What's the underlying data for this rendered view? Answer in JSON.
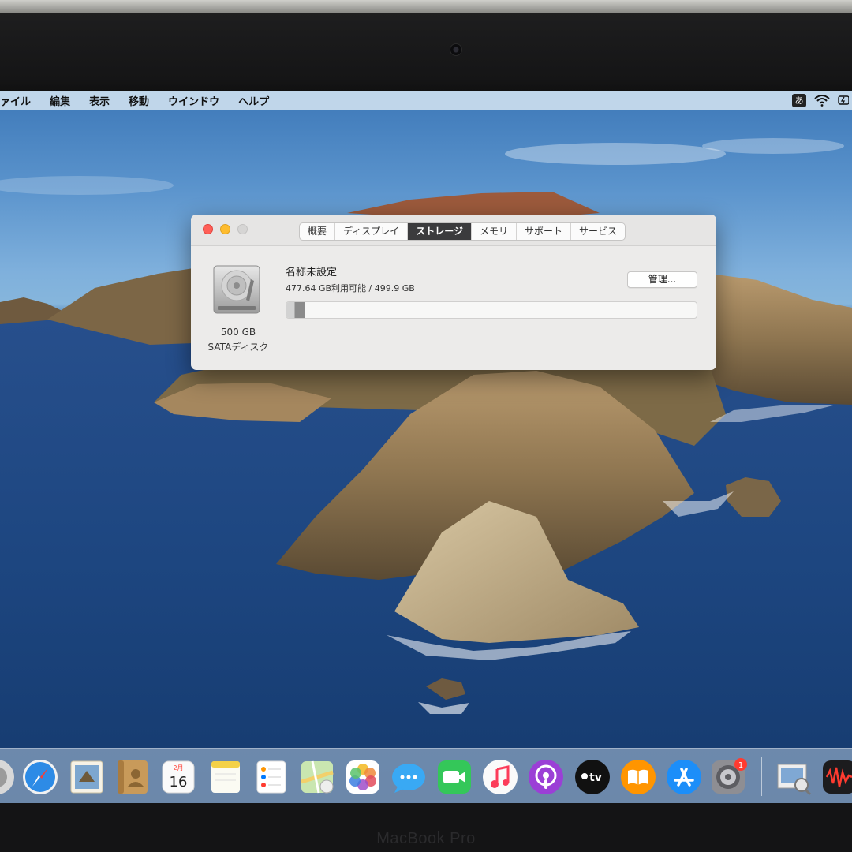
{
  "device": {
    "model_label": "MacBook Pro"
  },
  "menubar": {
    "items": [
      "ァイル",
      "編集",
      "表示",
      "移動",
      "ウインドウ",
      "ヘルプ"
    ],
    "input_source": "あ"
  },
  "about_window": {
    "tabs": [
      "概要",
      "ディスプレイ",
      "ストレージ",
      "メモリ",
      "サポート",
      "サービス"
    ],
    "active_tab": "ストレージ",
    "disk": {
      "size": "500 GB",
      "type": "SATAディスク"
    },
    "volume": {
      "name": "名称未設定",
      "usage": "477.64 GB利用可能 / 499.9 GB",
      "used_fraction": 0.045
    },
    "manage_button": "管理..."
  },
  "dock": {
    "icons": [
      "finder-icon",
      "safari-icon",
      "mail-icon",
      "contacts-icon",
      "calendar-icon",
      "notes-icon",
      "reminders-icon",
      "maps-icon",
      "photos-icon",
      "messages-icon",
      "facetime-icon",
      "music-icon",
      "podcasts-icon",
      "apple-tv-icon",
      "books-icon",
      "app-store-icon",
      "system-preferences-icon",
      "preview-icon",
      "voice-memos-icon"
    ],
    "calendar": {
      "month": "2月",
      "day": "16"
    },
    "tv_label": "tv",
    "system_preferences_badge": "1"
  }
}
